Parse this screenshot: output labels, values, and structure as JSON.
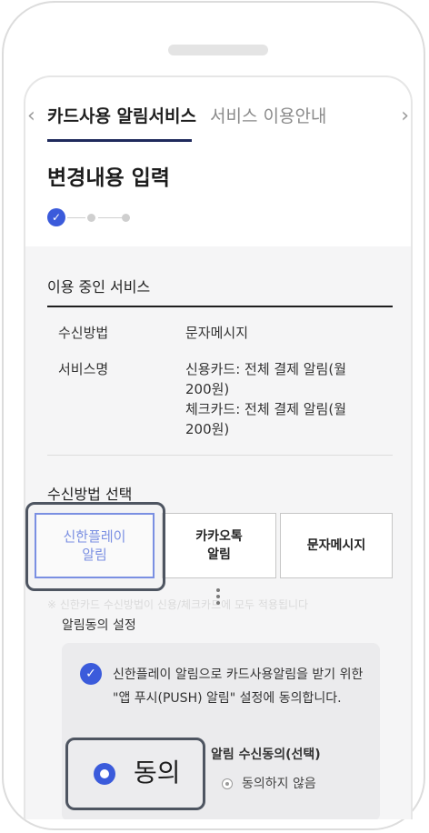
{
  "tabs": {
    "active": "카드사용 알림서비스",
    "inactive": "서비스 이용안내"
  },
  "page_title": "변경내용 입력",
  "steps": {
    "current": 1,
    "total": 3
  },
  "current_service": {
    "heading": "이용 중인 서비스",
    "method_label": "수신방법",
    "method_value": "문자메시지",
    "name_label": "서비스명",
    "name_value_1": "신용카드: 전체 결제 알림(월 200원)",
    "name_value_2": "체크카드: 전체 결제 알림(월 200원)"
  },
  "method_select": {
    "heading": "수신방법 선택",
    "options": [
      {
        "label": "신한플레이\n알림",
        "selected": true
      },
      {
        "label": "카카오톡\n알림",
        "selected": false
      },
      {
        "label": "문자메시지",
        "selected": false
      }
    ],
    "note_faded": "※ 신한카드 수신방법이 신용/체크카드에 모두 적용됩니다"
  },
  "consent": {
    "heading": "알림동의 설정",
    "text": "신한플레이 알림으로 카드사용알림을 받기 위한 \"앱 푸시(PUSH) 알림\" 설정에 동의합니다.",
    "sub_heading": "알림 수신동의(선택)",
    "agree_label": "동의",
    "disagree_label": "동의하지 않음",
    "agree_selected": true
  },
  "colors": {
    "accent": "#3b5bdb",
    "tab_underline": "#1f2a5c",
    "background_gray": "#f5f5f6"
  }
}
